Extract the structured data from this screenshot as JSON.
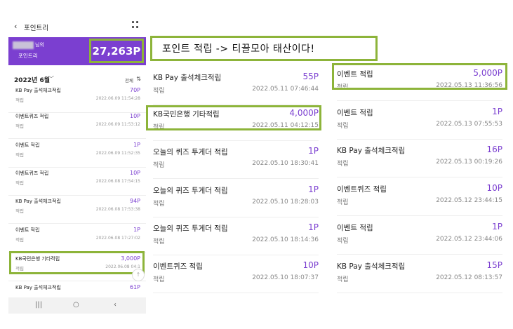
{
  "phone": {
    "back_icon": "‹",
    "title": "포인트리",
    "user_suffix": "님의",
    "point_label": "포인트리",
    "total": "27,263P",
    "month": "2022년 6월",
    "month_chevron": "﹀",
    "filter_label": "전체",
    "filter_icon": "⇅",
    "items": [
      {
        "title": "KB Pay 출석체크적립",
        "amount": "70P",
        "type": "적립",
        "time": "2022.06.09 11:54:28"
      },
      {
        "title": "이벤트퀴즈 적립",
        "amount": "10P",
        "type": "적립",
        "time": "2022.06.09 11:53:12"
      },
      {
        "title": "이벤트 적립",
        "amount": "1P",
        "type": "적립",
        "time": "2022.06.09 11:52:35"
      },
      {
        "title": "이벤트퀴즈 적립",
        "amount": "10P",
        "type": "적립",
        "time": "2022.06.08 17:54:15"
      },
      {
        "title": "KB Pay 출석체크적립",
        "amount": "94P",
        "type": "적립",
        "time": "2022.06.08 17:53:38"
      },
      {
        "title": "이벤트 적립",
        "amount": "1P",
        "type": "적립",
        "time": "2022.06.08 17:27:02"
      },
      {
        "title": "KB국민은행 기타적립",
        "amount": "3,000P",
        "type": "적립",
        "time": "2022.06.08 04:1"
      },
      {
        "title": "KB Pay 출석체크적립",
        "amount": "61P",
        "type": "",
        "time": ""
      }
    ],
    "nav": {
      "recent": "|||",
      "home": "○",
      "back": "‹"
    },
    "fab_icon": "↑"
  },
  "caption": "포인트 적립 -> 티끌모아 태산이다!",
  "column1": [
    {
      "title": "KB Pay 출석체크적립",
      "amount": "55P",
      "type": "적립",
      "time": "2022.05.11 07:46:44"
    },
    {
      "title": "KB국민은행 기타적립",
      "amount": "4,000P",
      "type": "적립",
      "time": "2022.05.11 04:12:15"
    },
    {
      "title": "오늘의 퀴즈 투게더 적립",
      "amount": "1P",
      "type": "적립",
      "time": "2022.05.10 18:30:41"
    },
    {
      "title": "오늘의 퀴즈 투게더 적립",
      "amount": "1P",
      "type": "적립",
      "time": "2022.05.10 18:28:03"
    },
    {
      "title": "오늘의 퀴즈 투게더 적립",
      "amount": "1P",
      "type": "적립",
      "time": "2022.05.10 18:14:36"
    },
    {
      "title": "이벤트퀴즈 적립",
      "amount": "10P",
      "type": "적립",
      "time": "2022.05.10 18:07:37"
    }
  ],
  "column2": [
    {
      "title": "이벤트 적립",
      "amount": "5,000P",
      "type": "적립",
      "time": "2022.05.13 11:36:56"
    },
    {
      "title": "이벤트 적립",
      "amount": "1P",
      "type": "적립",
      "time": "2022.05.13 07:55:53"
    },
    {
      "title": "KB Pay 출석체크적립",
      "amount": "16P",
      "type": "적립",
      "time": "2022.05.13 00:19:26"
    },
    {
      "title": "이벤트퀴즈 적립",
      "amount": "10P",
      "type": "적립",
      "time": "2022.05.12 23:44:15"
    },
    {
      "title": "이벤트 적립",
      "amount": "1P",
      "type": "적립",
      "time": "2022.05.12 23:44:06"
    },
    {
      "title": "KB Pay 출석체크적립",
      "amount": "15P",
      "type": "적립",
      "time": "2022.05.12 08:13:57"
    }
  ],
  "colors": {
    "accent": "#7b3fd0",
    "highlight": "#8db43a"
  }
}
